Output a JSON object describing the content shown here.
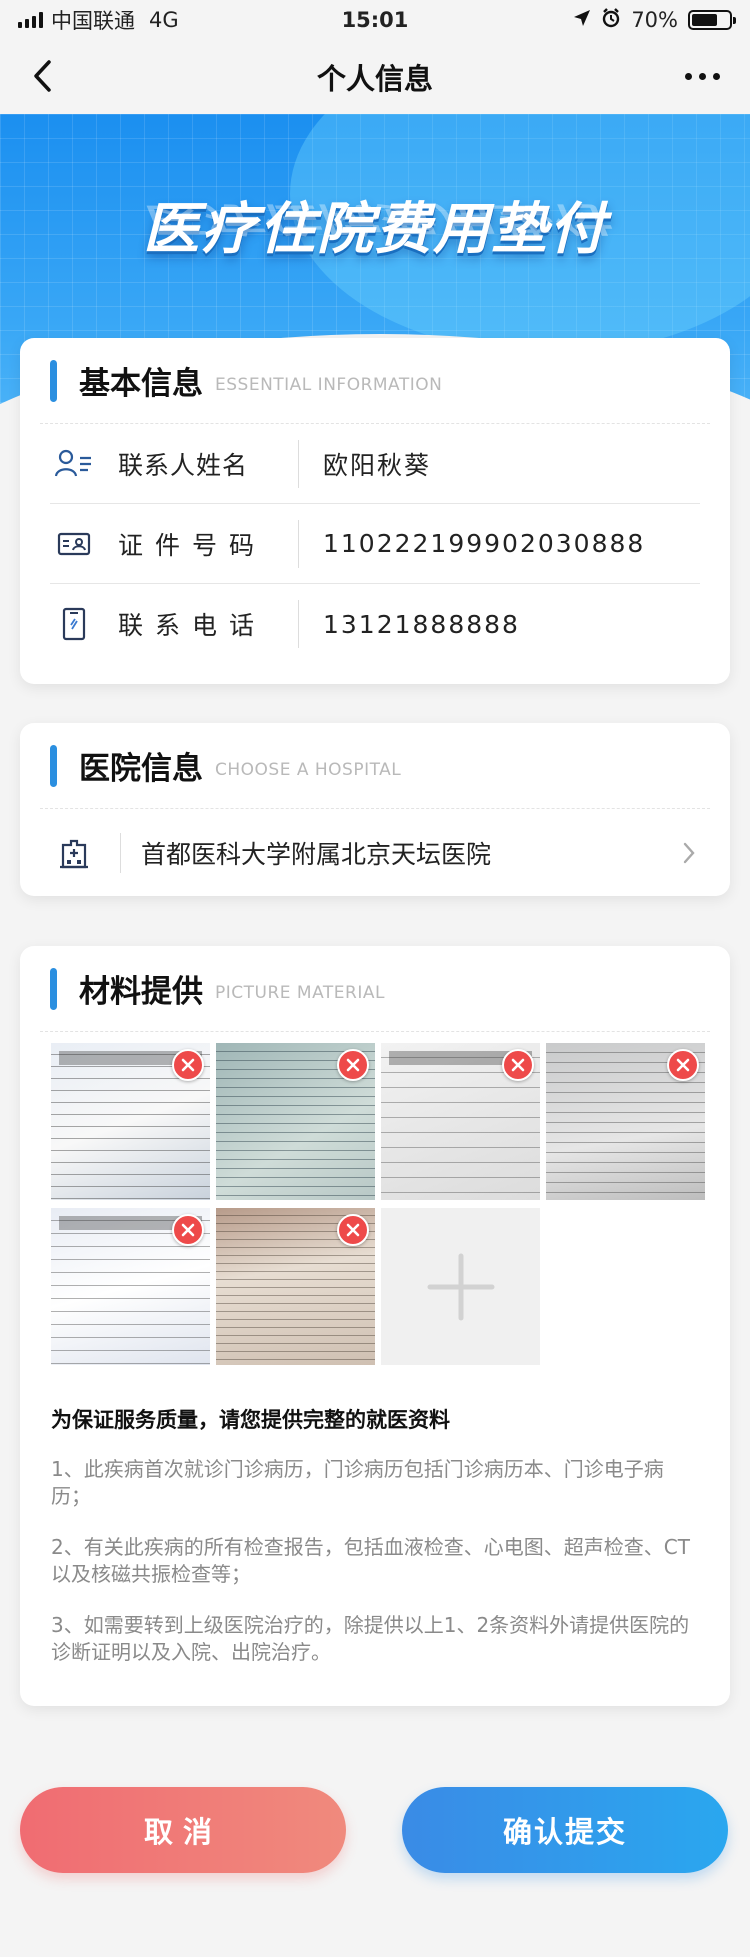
{
  "status_bar": {
    "carrier": "中国联通",
    "network": "4G",
    "time": "15:01",
    "battery": "70%"
  },
  "nav": {
    "title": "个人信息"
  },
  "banner": {
    "title": "医疗住院费用垫付"
  },
  "basic_info": {
    "title": "基本信息",
    "subtitle": "ESSENTIAL INFORMATION",
    "rows": [
      {
        "icon": "contact-person-icon",
        "label": "联系人姓名",
        "value": "欧阳秋葵"
      },
      {
        "icon": "id-card-icon",
        "label": "证件号码",
        "value": "110222199902030888"
      },
      {
        "icon": "phone-icon",
        "label": "联系电话",
        "value": "13121888888"
      }
    ]
  },
  "hospital_info": {
    "title": "医院信息",
    "subtitle": "CHOOSE A HOSPITAL",
    "selected": "首都医科大学附属北京天坛医院"
  },
  "materials": {
    "title": "材料提供",
    "subtitle": "PICTURE MATERIAL",
    "photo_count": 6,
    "notes_heading": "为保证服务质量，请您提供完整的就医资料",
    "notes": [
      "1、此疾病首次就诊门诊病历，门诊病历包括门诊病历本、门诊电子病历；",
      "2、有关此疾病的所有检查报告，包括血液检查、心电图、超声检查、CT以及核磁共振检查等；",
      "3、如需要转到上级医院治疗的，除提供以上1、2条资料外请提供医院的诊断证明以及入院、出院治疗。"
    ]
  },
  "actions": {
    "cancel": "取消",
    "submit": "确认提交"
  },
  "colors": {
    "accent": "#2b8fe0",
    "cancel": "#f06c72",
    "submit": "#2aa7ef",
    "delete": "#ee4a4a"
  }
}
